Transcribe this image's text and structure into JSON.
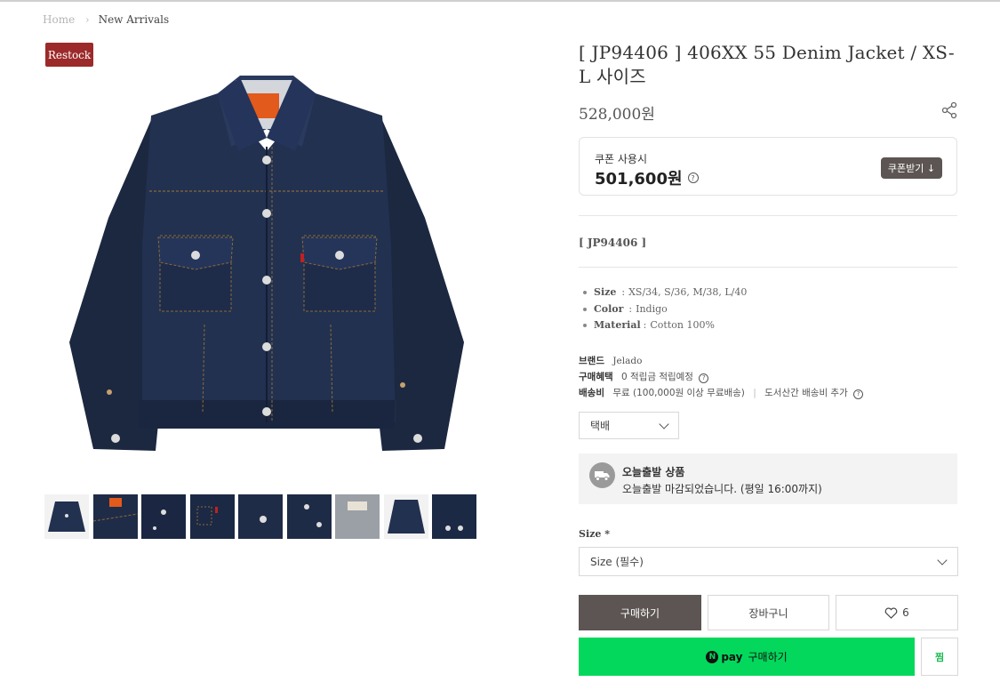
{
  "breadcrumb": {
    "home": "Home",
    "separator": "›",
    "current": "New Arrivals"
  },
  "badge": "Restock",
  "product": {
    "title": "[ JP94406 ] 406XX 55 Denim Jacket / XS-L 사이즈",
    "price": "528,000원",
    "code": "[ JP94406 ]"
  },
  "coupon": {
    "label": "쿠폰 사용시",
    "price": "501,600원",
    "button": "쿠폰받기 ↓"
  },
  "specs": [
    {
      "key": "Size",
      "value": "XS/34, S/36, M/38, L/40"
    },
    {
      "key": "Color",
      "value": "Indigo"
    },
    {
      "key": "Material",
      "value": "Cotton 100%"
    }
  ],
  "info": {
    "brand_label": "브랜드",
    "brand_value": "Jelado",
    "benefit_label": "구매혜택",
    "benefit_value": "0 적립금 적립예정",
    "shipping_label": "배송비",
    "shipping_value": "무료 (100,000원 이상 무료배송)",
    "shipping_extra": "도서산간 배송비 추가"
  },
  "shipping_method": "택배",
  "today_ship": {
    "title": "오늘출발 상품",
    "subtitle": "오늘출발 마감되었습니다. (평일 16:00까지)"
  },
  "size_select": {
    "label": "Size *",
    "placeholder": "Size (필수)"
  },
  "buttons": {
    "buy": "구매하기",
    "cart": "장바구니",
    "wish_count": "6",
    "npay_brand": "pay",
    "npay_label": "구매하기",
    "zzim": "찜"
  },
  "icons": [
    "chevron-right-icon",
    "share-icon",
    "question-icon",
    "download-icon",
    "chevron-down-icon",
    "truck-icon",
    "heart-icon",
    "naver-n-icon"
  ],
  "colors": {
    "badge": "#9c2a2a",
    "buy": "#5c5553",
    "npay": "#03d85c",
    "zzim": "#1db954"
  }
}
